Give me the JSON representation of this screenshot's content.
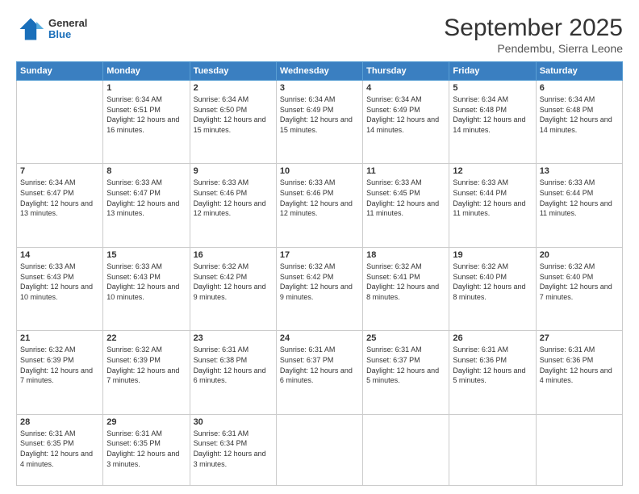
{
  "header": {
    "logo": {
      "general": "General",
      "blue": "Blue"
    },
    "title": "September 2025",
    "location": "Pendembu, Sierra Leone"
  },
  "calendar": {
    "days_of_week": [
      "Sunday",
      "Monday",
      "Tuesday",
      "Wednesday",
      "Thursday",
      "Friday",
      "Saturday"
    ],
    "weeks": [
      [
        {
          "day": "",
          "sunrise": "",
          "sunset": "",
          "daylight": ""
        },
        {
          "day": "1",
          "sunrise": "Sunrise: 6:34 AM",
          "sunset": "Sunset: 6:51 PM",
          "daylight": "Daylight: 12 hours and 16 minutes."
        },
        {
          "day": "2",
          "sunrise": "Sunrise: 6:34 AM",
          "sunset": "Sunset: 6:50 PM",
          "daylight": "Daylight: 12 hours and 15 minutes."
        },
        {
          "day": "3",
          "sunrise": "Sunrise: 6:34 AM",
          "sunset": "Sunset: 6:49 PM",
          "daylight": "Daylight: 12 hours and 15 minutes."
        },
        {
          "day": "4",
          "sunrise": "Sunrise: 6:34 AM",
          "sunset": "Sunset: 6:49 PM",
          "daylight": "Daylight: 12 hours and 14 minutes."
        },
        {
          "day": "5",
          "sunrise": "Sunrise: 6:34 AM",
          "sunset": "Sunset: 6:48 PM",
          "daylight": "Daylight: 12 hours and 14 minutes."
        },
        {
          "day": "6",
          "sunrise": "Sunrise: 6:34 AM",
          "sunset": "Sunset: 6:48 PM",
          "daylight": "Daylight: 12 hours and 14 minutes."
        }
      ],
      [
        {
          "day": "7",
          "sunrise": "Sunrise: 6:34 AM",
          "sunset": "Sunset: 6:47 PM",
          "daylight": "Daylight: 12 hours and 13 minutes."
        },
        {
          "day": "8",
          "sunrise": "Sunrise: 6:33 AM",
          "sunset": "Sunset: 6:47 PM",
          "daylight": "Daylight: 12 hours and 13 minutes."
        },
        {
          "day": "9",
          "sunrise": "Sunrise: 6:33 AM",
          "sunset": "Sunset: 6:46 PM",
          "daylight": "Daylight: 12 hours and 12 minutes."
        },
        {
          "day": "10",
          "sunrise": "Sunrise: 6:33 AM",
          "sunset": "Sunset: 6:46 PM",
          "daylight": "Daylight: 12 hours and 12 minutes."
        },
        {
          "day": "11",
          "sunrise": "Sunrise: 6:33 AM",
          "sunset": "Sunset: 6:45 PM",
          "daylight": "Daylight: 12 hours and 11 minutes."
        },
        {
          "day": "12",
          "sunrise": "Sunrise: 6:33 AM",
          "sunset": "Sunset: 6:44 PM",
          "daylight": "Daylight: 12 hours and 11 minutes."
        },
        {
          "day": "13",
          "sunrise": "Sunrise: 6:33 AM",
          "sunset": "Sunset: 6:44 PM",
          "daylight": "Daylight: 12 hours and 11 minutes."
        }
      ],
      [
        {
          "day": "14",
          "sunrise": "Sunrise: 6:33 AM",
          "sunset": "Sunset: 6:43 PM",
          "daylight": "Daylight: 12 hours and 10 minutes."
        },
        {
          "day": "15",
          "sunrise": "Sunrise: 6:33 AM",
          "sunset": "Sunset: 6:43 PM",
          "daylight": "Daylight: 12 hours and 10 minutes."
        },
        {
          "day": "16",
          "sunrise": "Sunrise: 6:32 AM",
          "sunset": "Sunset: 6:42 PM",
          "daylight": "Daylight: 12 hours and 9 minutes."
        },
        {
          "day": "17",
          "sunrise": "Sunrise: 6:32 AM",
          "sunset": "Sunset: 6:42 PM",
          "daylight": "Daylight: 12 hours and 9 minutes."
        },
        {
          "day": "18",
          "sunrise": "Sunrise: 6:32 AM",
          "sunset": "Sunset: 6:41 PM",
          "daylight": "Daylight: 12 hours and 8 minutes."
        },
        {
          "day": "19",
          "sunrise": "Sunrise: 6:32 AM",
          "sunset": "Sunset: 6:40 PM",
          "daylight": "Daylight: 12 hours and 8 minutes."
        },
        {
          "day": "20",
          "sunrise": "Sunrise: 6:32 AM",
          "sunset": "Sunset: 6:40 PM",
          "daylight": "Daylight: 12 hours and 7 minutes."
        }
      ],
      [
        {
          "day": "21",
          "sunrise": "Sunrise: 6:32 AM",
          "sunset": "Sunset: 6:39 PM",
          "daylight": "Daylight: 12 hours and 7 minutes."
        },
        {
          "day": "22",
          "sunrise": "Sunrise: 6:32 AM",
          "sunset": "Sunset: 6:39 PM",
          "daylight": "Daylight: 12 hours and 7 minutes."
        },
        {
          "day": "23",
          "sunrise": "Sunrise: 6:31 AM",
          "sunset": "Sunset: 6:38 PM",
          "daylight": "Daylight: 12 hours and 6 minutes."
        },
        {
          "day": "24",
          "sunrise": "Sunrise: 6:31 AM",
          "sunset": "Sunset: 6:37 PM",
          "daylight": "Daylight: 12 hours and 6 minutes."
        },
        {
          "day": "25",
          "sunrise": "Sunrise: 6:31 AM",
          "sunset": "Sunset: 6:37 PM",
          "daylight": "Daylight: 12 hours and 5 minutes."
        },
        {
          "day": "26",
          "sunrise": "Sunrise: 6:31 AM",
          "sunset": "Sunset: 6:36 PM",
          "daylight": "Daylight: 12 hours and 5 minutes."
        },
        {
          "day": "27",
          "sunrise": "Sunrise: 6:31 AM",
          "sunset": "Sunset: 6:36 PM",
          "daylight": "Daylight: 12 hours and 4 minutes."
        }
      ],
      [
        {
          "day": "28",
          "sunrise": "Sunrise: 6:31 AM",
          "sunset": "Sunset: 6:35 PM",
          "daylight": "Daylight: 12 hours and 4 minutes."
        },
        {
          "day": "29",
          "sunrise": "Sunrise: 6:31 AM",
          "sunset": "Sunset: 6:35 PM",
          "daylight": "Daylight: 12 hours and 3 minutes."
        },
        {
          "day": "30",
          "sunrise": "Sunrise: 6:31 AM",
          "sunset": "Sunset: 6:34 PM",
          "daylight": "Daylight: 12 hours and 3 minutes."
        },
        {
          "day": "",
          "sunrise": "",
          "sunset": "",
          "daylight": ""
        },
        {
          "day": "",
          "sunrise": "",
          "sunset": "",
          "daylight": ""
        },
        {
          "day": "",
          "sunrise": "",
          "sunset": "",
          "daylight": ""
        },
        {
          "day": "",
          "sunrise": "",
          "sunset": "",
          "daylight": ""
        }
      ]
    ]
  }
}
